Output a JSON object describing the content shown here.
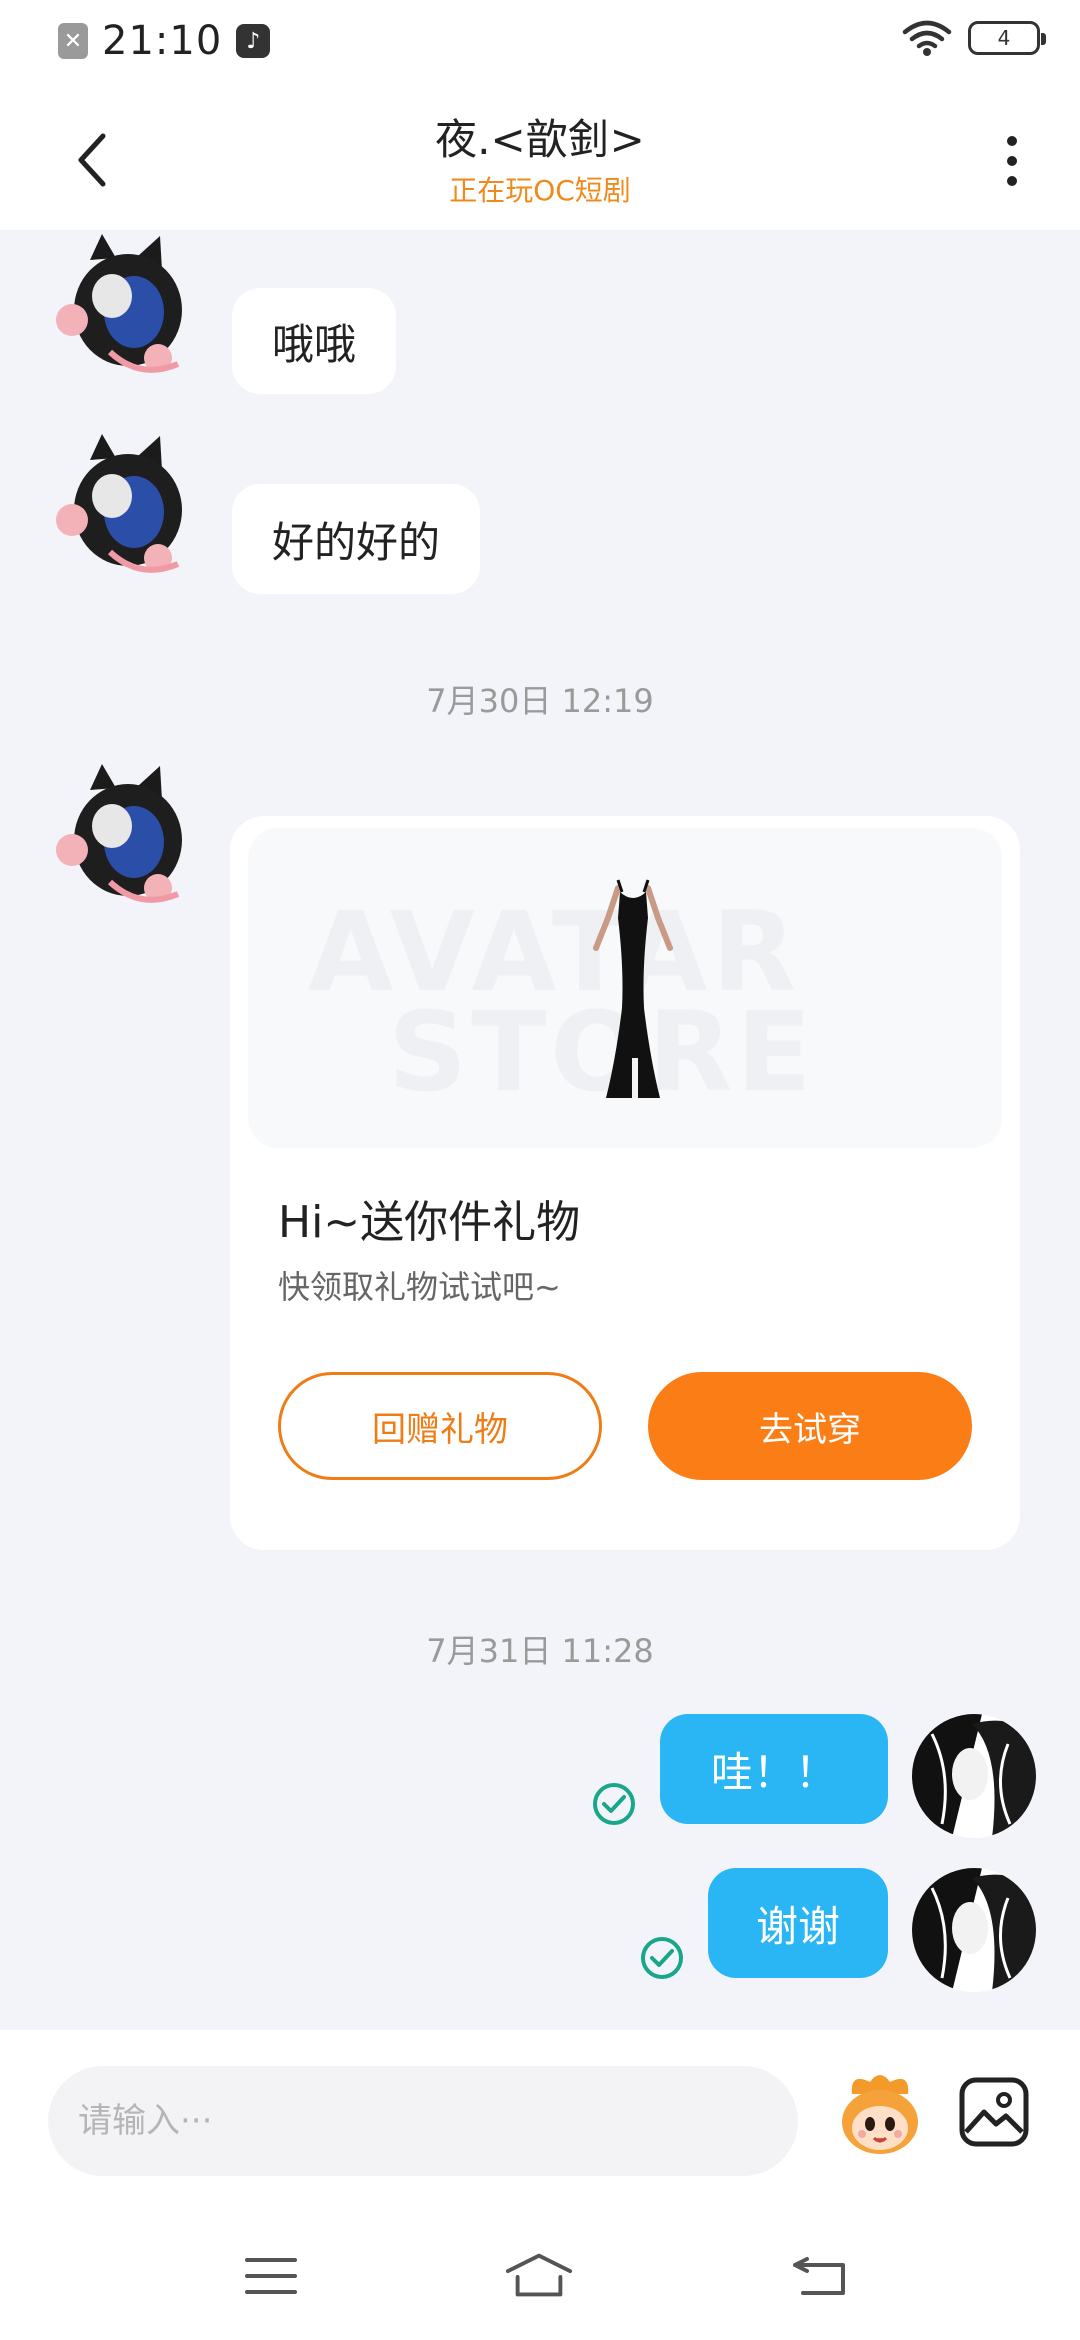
{
  "status_bar": {
    "time": "21:10",
    "battery": "4",
    "icons": [
      "notification-x-icon",
      "music-app-icon",
      "wifi-icon",
      "battery-icon"
    ]
  },
  "header": {
    "title": "夜.<歆釗>",
    "subtitle": "正在玩OC短剧",
    "icons": [
      "back-arrow-icon",
      "more-vertical-icon"
    ]
  },
  "messages": {
    "m1": "哦哦",
    "m2": "好的好的",
    "ts1": "7月30日 12:19",
    "ts2": "7月31日 11:28",
    "m3": "哇！！",
    "m4": "谢谢"
  },
  "gift_card": {
    "title": "Hi~送你件礼物",
    "subtitle": "快领取礼物试试吧~",
    "watermark_line1": "AVATAR",
    "watermark_line2": "STORE",
    "btn_return": "回赠礼物",
    "btn_try": "去试穿"
  },
  "input_bar": {
    "placeholder": "请输入···",
    "icons": [
      "emoji-mascot-icon",
      "image-picker-icon"
    ]
  },
  "nav": {
    "icons": [
      "menu-icon",
      "home-icon",
      "back-icon"
    ]
  },
  "colors": {
    "accent_orange": "#fb7d16",
    "subtitle_orange": "#f08a1c",
    "my_bubble": "#2ab6f5",
    "background": "#f3f4f9",
    "check_green": "#1aa68a"
  }
}
